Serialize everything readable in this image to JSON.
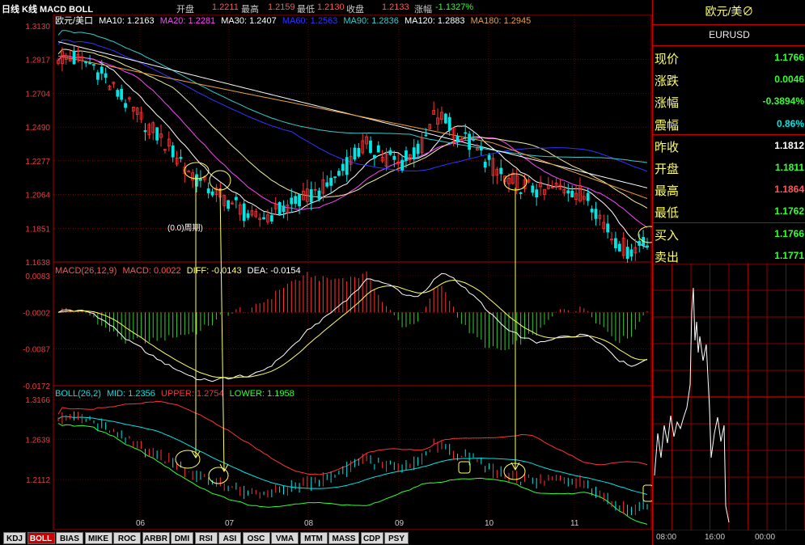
{
  "topbar": {
    "title": "日线 K线 MACD BOLL",
    "open_label": "开盘",
    "open_val": "1.2211",
    "high_label": "最高",
    "high_val": "1.2159",
    "low_label": "最低",
    "low_val": "1.2130",
    "close_label": "收盘",
    "close_val": "1.2133",
    "chg_label": "涨幅",
    "chg_val": "-1.1327%"
  },
  "main_legend": {
    "name": "欧元/美口",
    "ma10": "MA10: 1.2163",
    "ma20": "MA20: 1.2281",
    "ma30": "MA30: 1.2407",
    "ma60": "MA60: 1.2563",
    "ma90": "MA90: 1.2836",
    "ma120": "MA120: 1.2883",
    "ma180": "MA180: 1.2945"
  },
  "main_axis": [
    "1.3130",
    "1.2917",
    "1.2704",
    "1.2490",
    "1.2277",
    "1.2064",
    "1.1851",
    "1.1638"
  ],
  "annotation": "(0.0)周期)",
  "macd_legend": {
    "name": "MACD(26,12,9)",
    "macd": "MACD: 0.0022",
    "diff": "DIFF: -0.0143",
    "dea": "DEA: -0.0154"
  },
  "macd_axis": [
    "0.0083",
    "-0.0002",
    "-0.0087",
    "-0.0172"
  ],
  "boll_legend": {
    "name": "BOLL(26,2)",
    "mid": "MID: 1.2356",
    "upper": "UPPER: 1.2754",
    "lower": "LOWER: 1.1958"
  },
  "boll_axis": [
    "1.3166",
    "1.2639",
    "1.2112"
  ],
  "x_axis": [
    "06",
    "07",
    "08",
    "09",
    "10",
    "11"
  ],
  "quote": {
    "title": "欧元/美∅",
    "code": "EURUSD",
    "rows": [
      {
        "label": "现价",
        "value": "1.1766"
      },
      {
        "label": "涨跌",
        "value": "0.0046"
      },
      {
        "label": "涨幅",
        "value": "-0.3894%"
      },
      {
        "label": "震幅",
        "value": "0.86%"
      },
      {
        "label": "昨收",
        "value": "1.1812"
      },
      {
        "label": "开盘",
        "value": "1.1811"
      },
      {
        "label": "最高",
        "value": "1.1864"
      },
      {
        "label": "最低",
        "value": "1.1762"
      },
      {
        "label": "买入",
        "value": "1.1766"
      },
      {
        "label": "卖出",
        "value": "1.1771"
      }
    ],
    "times": [
      "08:00",
      "16:00",
      "00:00"
    ]
  },
  "tabs": [
    "KDJ",
    "BOLL",
    "BIAS",
    "MIKE",
    "ROC",
    "ARBR",
    "DMI",
    "RSI",
    "ASI",
    "OSC",
    "VMA",
    "MTM",
    "MASS",
    "CDP",
    "PSY"
  ],
  "active_tab": "BOLL",
  "colors": {
    "up": "#ff3333",
    "down": "#00e5e5",
    "ma10": "#ffffff",
    "ma20": "#ff44ff",
    "ma30": "#ffffff",
    "ma60": "#3333ff",
    "ma90": "#33cccc",
    "ma120": "#ffffff",
    "ma180": "#e8a040",
    "grid": "#b00000",
    "diff": "#ffffff",
    "dea": "#ffff66",
    "upper": "#ff3333",
    "lower": "#33ff33",
    "mid": "#00e5e5"
  }
}
